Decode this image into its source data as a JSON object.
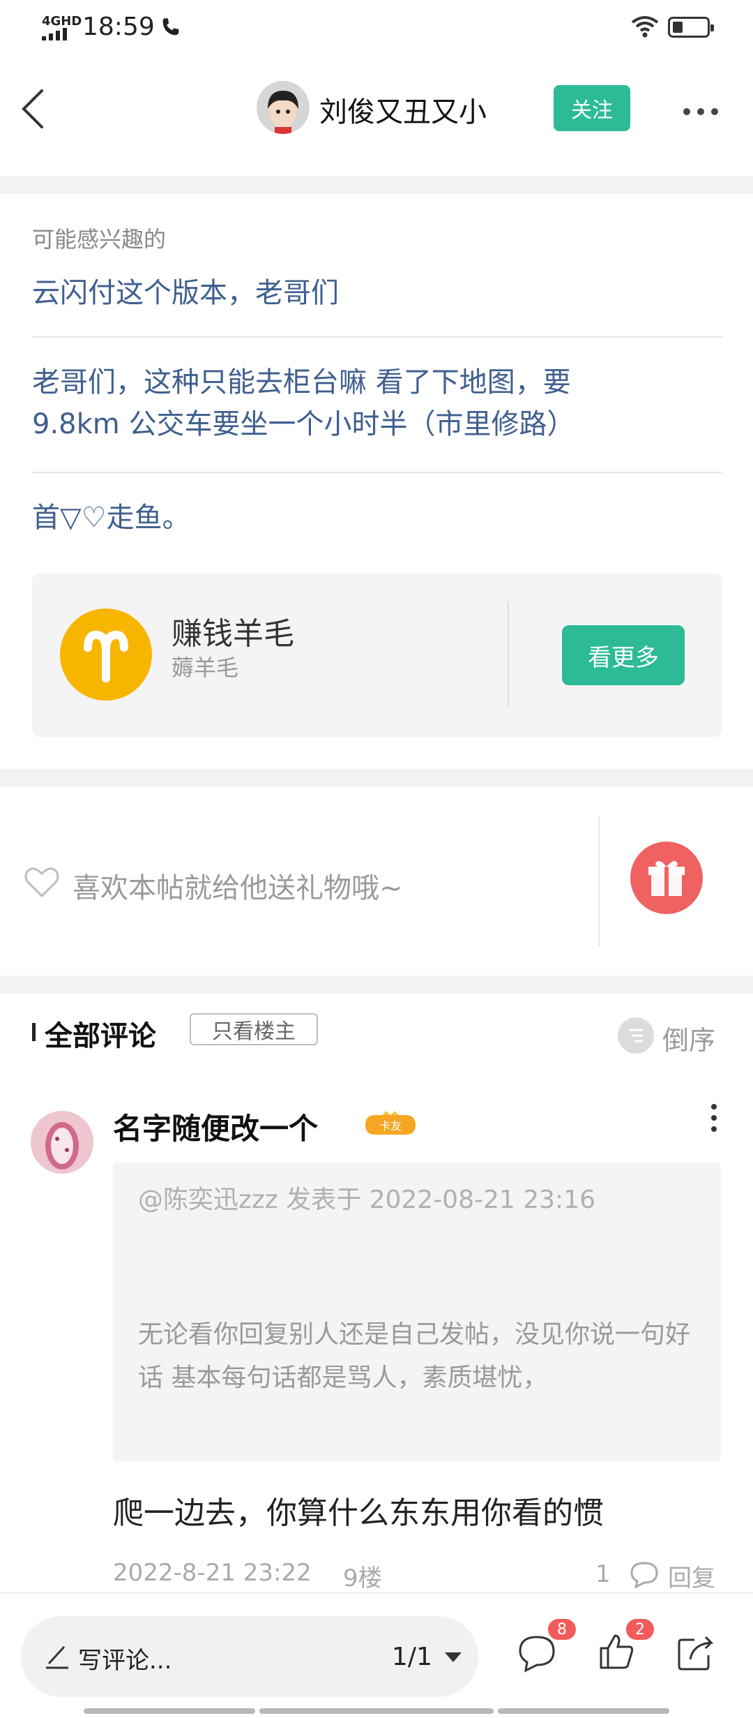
{
  "status_bar": {
    "network": "4GHD",
    "time": "18:59"
  },
  "header": {
    "author": "刘俊又丑又小",
    "follow_label": "关注"
  },
  "interest": {
    "title": "可能感兴趣的",
    "links": [
      "云闪付这个版本，老哥们",
      "老哥们，这种只能去柜台嘛 看了下地图，要",
      "9.8km 公交车要坐一个小时半（市里修路）",
      "首▽♡走鱼。"
    ]
  },
  "topic": {
    "name": "赚钱羊毛",
    "subtitle": "薅羊毛",
    "button": "看更多"
  },
  "gift": {
    "prompt": "喜欢本帖就给他送礼物哦~"
  },
  "comments": {
    "title": "全部评论",
    "filter": "只看楼主",
    "sort": "倒序",
    "items": [
      {
        "user": "名字随便改一个",
        "badge": "卡友",
        "quote_head": "@陈奕迅zzz 发表于 2022-08-21 23:16",
        "quote_body": "无论看你回复别人还是自己发帖，没见你说一句好话 基本每句话都是骂人，素质堪忧，",
        "text": "爬一边去，你算什么东东用你看的惯",
        "time": "2022-8-21 23:22",
        "floor": "9楼",
        "likes": "1",
        "reply_label": "回复"
      }
    ]
  },
  "bottom_bar": {
    "write_placeholder": "写评论...",
    "page": "1/1",
    "comment_count": "8",
    "like_count": "2"
  },
  "colors": {
    "accent": "#2dbb97",
    "link": "#3f5f8f",
    "badge": "#f25b5b",
    "topic_icon": "#f8b500"
  }
}
